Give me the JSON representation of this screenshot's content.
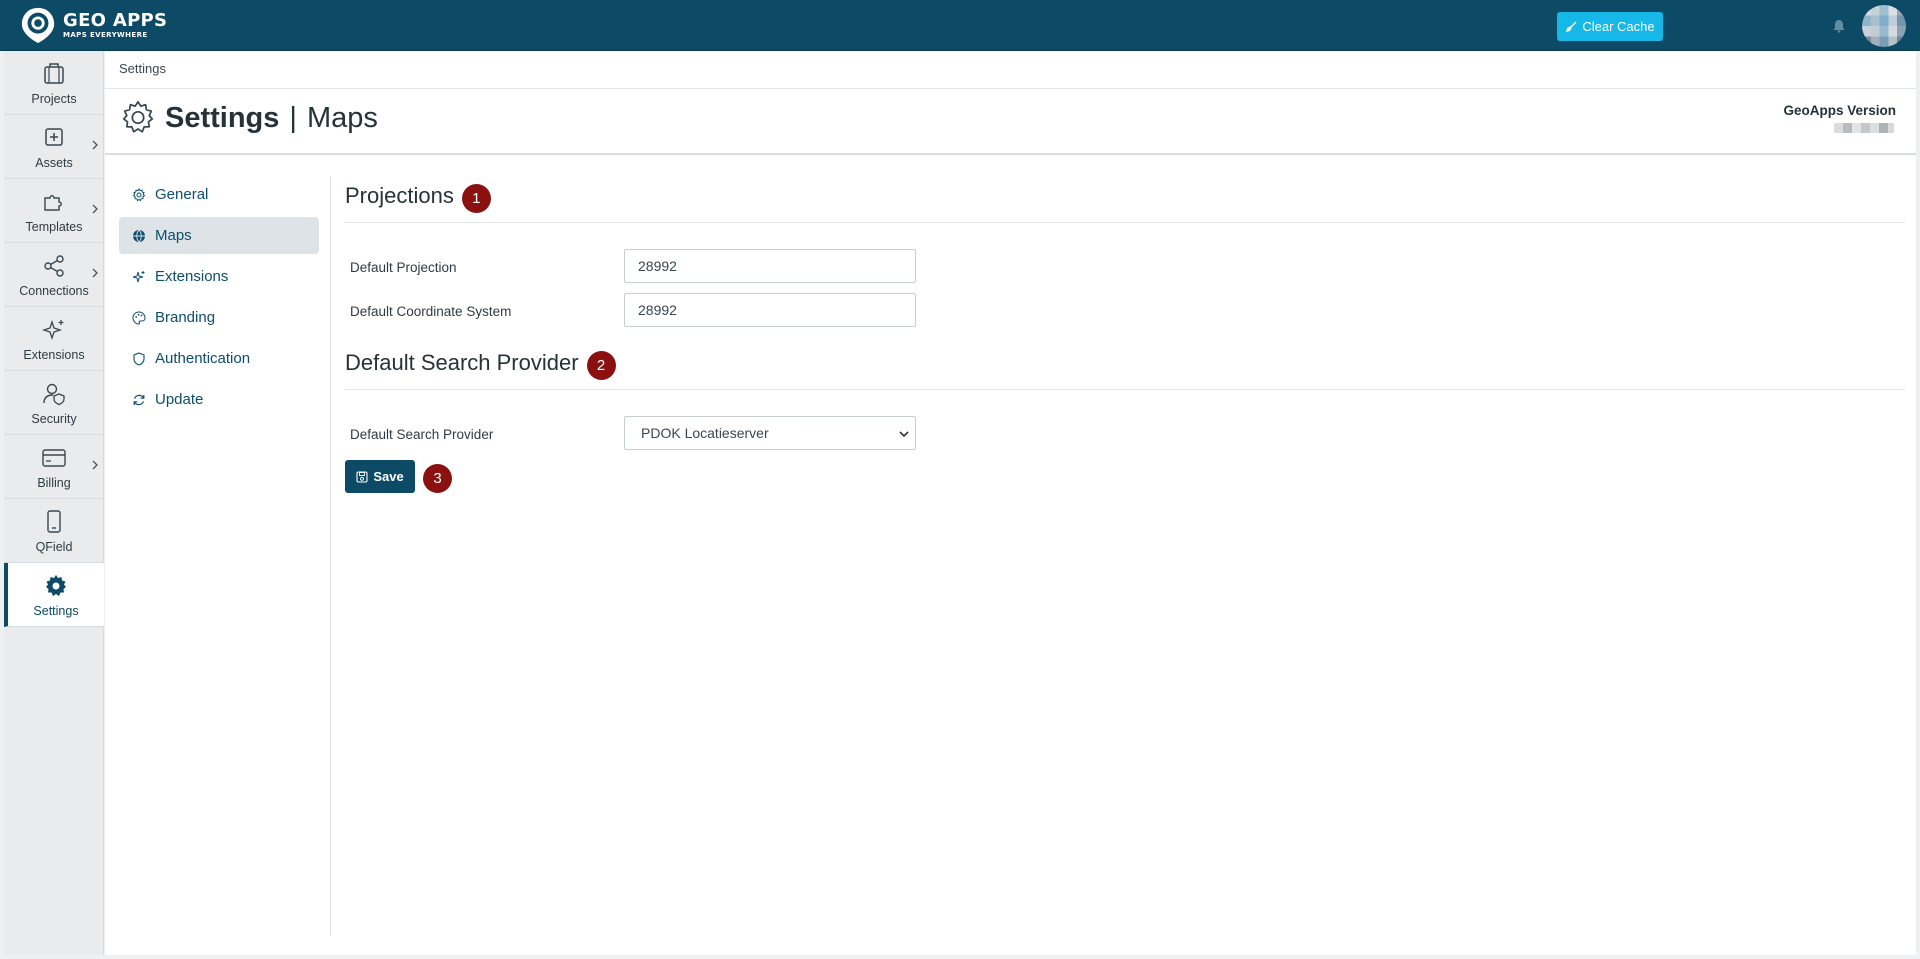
{
  "brand": {
    "title": "GEO APPS",
    "subtitle": "MAPS EVERYWHERE"
  },
  "topbar": {
    "clear_cache_label": "Clear Cache"
  },
  "leftnav": {
    "items": [
      {
        "label": "Projects",
        "icon": "briefcase-icon",
        "has_chevron": false
      },
      {
        "label": "Assets",
        "icon": "plus-square-icon",
        "has_chevron": true
      },
      {
        "label": "Templates",
        "icon": "puzzle-icon",
        "has_chevron": true
      },
      {
        "label": "Connections",
        "icon": "share-nodes-icon",
        "has_chevron": true
      },
      {
        "label": "Extensions",
        "icon": "sparkles-icon",
        "has_chevron": false
      },
      {
        "label": "Security",
        "icon": "user-shield-icon",
        "has_chevron": false
      },
      {
        "label": "Billing",
        "icon": "credit-card-icon",
        "has_chevron": true
      },
      {
        "label": "QField",
        "icon": "smartphone-icon",
        "has_chevron": false
      },
      {
        "label": "Settings",
        "icon": "gear-icon",
        "has_chevron": false,
        "active": true
      }
    ]
  },
  "breadcrumb": "Settings",
  "page": {
    "title": "Settings",
    "separator": "|",
    "subtitle": "Maps",
    "version_label": "GeoApps Version"
  },
  "submenu": {
    "items": [
      {
        "label": "General",
        "icon": "gear-icon"
      },
      {
        "label": "Maps",
        "icon": "globe-icon",
        "active": true
      },
      {
        "label": "Extensions",
        "icon": "sparkles-icon"
      },
      {
        "label": "Branding",
        "icon": "palette-icon"
      },
      {
        "label": "Authentication",
        "icon": "shield-icon"
      },
      {
        "label": "Update",
        "icon": "refresh-icon"
      }
    ]
  },
  "projections": {
    "title": "Projections",
    "badge": "1",
    "default_projection_label": "Default Projection",
    "default_projection_value": "28992",
    "default_coordinate_system_label": "Default Coordinate System",
    "default_coordinate_system_value": "28992"
  },
  "search_provider": {
    "title": "Default Search Provider",
    "badge": "2",
    "label": "Default Search Provider",
    "selected": "PDOK Locatieserver"
  },
  "actions": {
    "save_label": "Save",
    "badge": "3"
  },
  "colors": {
    "brand_dark": "#0c4a66",
    "accent_cyan": "#15b8e6",
    "badge_red": "#8b1111",
    "active_submenu_bg": "#dde3e7"
  }
}
